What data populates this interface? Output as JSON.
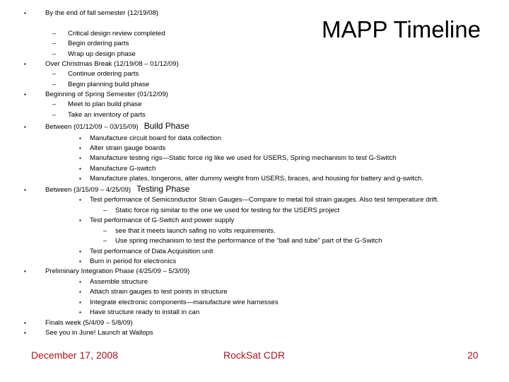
{
  "slide": {
    "title": "MAPP Timeline",
    "bullet_glyph": "▪",
    "dash_glyph": "–",
    "items": [
      {
        "level": 1,
        "text": "By the end of fall semester (12/19/08)"
      },
      {
        "level": 2,
        "marker": "dash",
        "text": "Critical design review completed"
      },
      {
        "level": 2,
        "marker": "dash",
        "text": "Begin ordering parts"
      },
      {
        "level": 2,
        "marker": "dash",
        "text": "Wrap up design phase"
      },
      {
        "level": 1,
        "text": "Over Christmas Break (12/19/08 – 01/12/09)"
      },
      {
        "level": 2,
        "marker": "dash",
        "text": "Continue ordering parts"
      },
      {
        "level": 2,
        "marker": "dash",
        "text": "Begin planning build phase"
      },
      {
        "level": 1,
        "text": "Beginning of Spring Semester (01/12/09)"
      },
      {
        "level": 2,
        "marker": "dash",
        "text": "Meet to plan build phase"
      },
      {
        "level": 2,
        "marker": "dash",
        "text": "Take an inventory of parts"
      },
      {
        "level": 1,
        "text": "Between (01/12/09 – 03/15/09)",
        "phase": "Build Phase"
      },
      {
        "level": 3,
        "marker": "bullet",
        "text": "Manufacture circuit board for data collection"
      },
      {
        "level": 3,
        "marker": "bullet",
        "text": "Alter strain gauge boards"
      },
      {
        "level": 3,
        "marker": "bullet",
        "text": "Manufacture testing rigs—Static force rig like we used for USERS, Spring mechanism to test G-Switch"
      },
      {
        "level": 3,
        "marker": "bullet",
        "text": "Manufacture G-switch"
      },
      {
        "level": 3,
        "marker": "bullet",
        "text": "Manufacture plates, longerons, alter dummy weight from USERS, braces, and housing for battery and g-switch."
      },
      {
        "level": 1,
        "text": "Between (3/15/09 – 4/25/09)",
        "phase": "Testing Phase"
      },
      {
        "level": 3,
        "marker": "bullet",
        "text": "Test performance of Semiconductor Strain Gauges—Compare to metal foil strain gauges. Also test temperature drift."
      },
      {
        "level": 4,
        "marker": "dash",
        "text": "Static force rig similar to the one we used for testing for the USERS project"
      },
      {
        "level": 3,
        "marker": "bullet",
        "text": "Test performance of G-Switch and power supply"
      },
      {
        "level": 4,
        "marker": "dash",
        "text": "see that it meets launch safing  no volts requirements."
      },
      {
        "level": 4,
        "marker": "dash",
        "text": "Use spring mechanism to test the performance of the \"ball and tube\" part of the G-Switch"
      },
      {
        "level": 3,
        "marker": "bullet",
        "text": "Test performance of Data Acquisition unit"
      },
      {
        "level": 3,
        "marker": "bullet",
        "text": "Burn in period for electronics"
      },
      {
        "level": 1,
        "text": "Preliminary Integration Phase (4/25/09 – 5/3/09)"
      },
      {
        "level": 3,
        "marker": "bullet",
        "text": "Assemble structure"
      },
      {
        "level": 3,
        "marker": "bullet",
        "text": "Attach strain gauges to test points in structure"
      },
      {
        "level": 3,
        "marker": "bullet",
        "text": "Integrate electronic components—manufacture wire harnesses"
      },
      {
        "level": 3,
        "marker": "bullet",
        "text": "Have structure ready to install in can"
      },
      {
        "level": 1,
        "text": "Finals week (5/4/09 – 5/8/09)"
      },
      {
        "level": 1,
        "text": "See you in June!  Launch at Wallops"
      }
    ]
  },
  "footer": {
    "date": "December 17, 2008",
    "center": "RockSat CDR",
    "page_number": "20",
    "color": "#b0141e"
  }
}
